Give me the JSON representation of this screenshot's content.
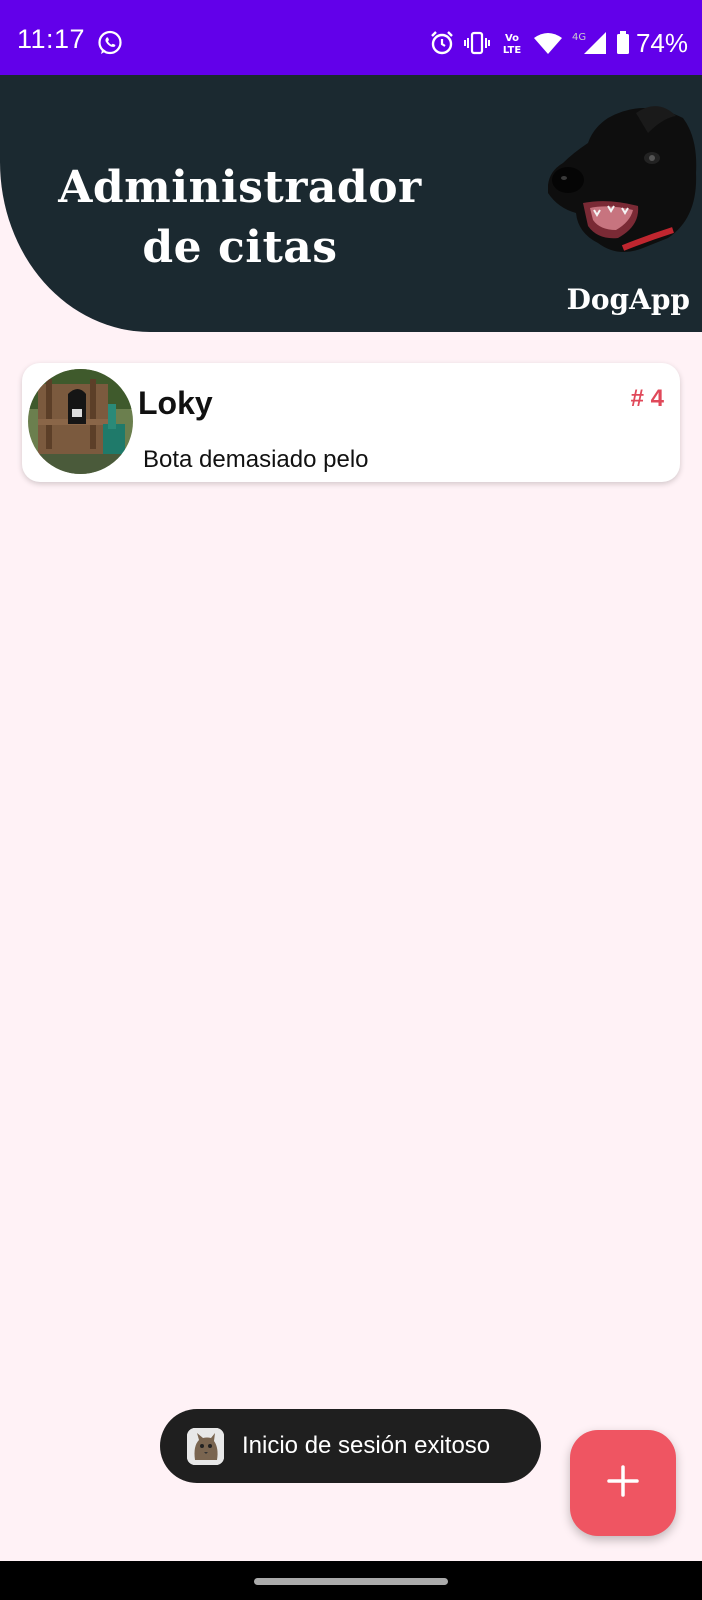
{
  "status_bar": {
    "time": "11:17",
    "battery": "74%",
    "left_icons": [
      "whatsapp-icon"
    ],
    "right_icons": [
      "alarm-icon",
      "vibrate-icon",
      "volte-icon",
      "wifi-icon",
      "signal-4g-icon",
      "battery-icon"
    ],
    "background_color": "#6200ea"
  },
  "header": {
    "title_line1": "Administrador",
    "title_line2": "de citas",
    "brand": "DogApp",
    "background_color": "#1b2930"
  },
  "appointments": [
    {
      "name": "Loky",
      "number": "# 4",
      "description": "Bota demasiado pelo"
    }
  ],
  "toast": {
    "message": "Inicio de sesión exitoso"
  },
  "fab": {
    "icon": "plus-icon",
    "color": "#ef5562"
  },
  "colors": {
    "page_background": "#fff2f6",
    "accent": "#e0495a"
  }
}
